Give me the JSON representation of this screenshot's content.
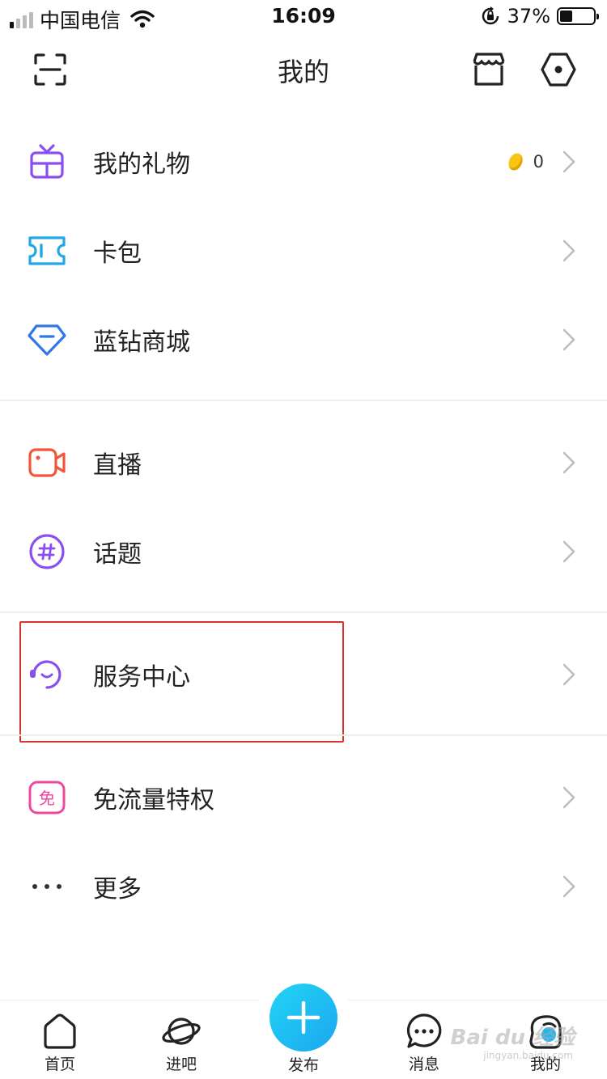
{
  "status_bar": {
    "carrier": "中国电信",
    "time": "16:09",
    "battery_percent": "37%",
    "battery_level": 0.37,
    "signal_bars_active": 1,
    "signal_bars_total": 4
  },
  "header": {
    "title": "我的",
    "left_icon": "scan-icon",
    "right_icons": [
      "store-icon",
      "settings-icon"
    ]
  },
  "menu": {
    "gift": {
      "label": "我的礼物",
      "count": "0",
      "icon": "gift-icon",
      "color": "#8a4ff0"
    },
    "cardpack": {
      "label": "卡包",
      "icon": "ticket-icon",
      "color": "#1fa7e6"
    },
    "bluediamond": {
      "label": "蓝钻商城",
      "icon": "diamond-icon",
      "color": "#2f78e8"
    },
    "live": {
      "label": "直播",
      "icon": "video-camera-icon",
      "color": "#f2563a"
    },
    "topic": {
      "label": "话题",
      "icon": "hashtag-icon",
      "color": "#8a4ff0"
    },
    "service": {
      "label": "服务中心",
      "icon": "headset-icon",
      "color": "#8a4ff0"
    },
    "freeflow": {
      "label": "免流量特权",
      "icon": "free-badge-icon",
      "badge_text": "免",
      "color": "#f0479d"
    },
    "more": {
      "label": "更多",
      "icon": "more-dots-icon"
    }
  },
  "highlight_color": "#d9322f",
  "tabbar": {
    "tabs": [
      {
        "label": "首页",
        "icon": "home-icon"
      },
      {
        "label": "进吧",
        "icon": "planet-icon"
      },
      {
        "label": "发布",
        "icon": "plus-icon"
      },
      {
        "label": "消息",
        "icon": "chat-bubble-icon"
      },
      {
        "label": "我的",
        "icon": "profile-face-icon"
      }
    ],
    "publish_color": "#1fb5f2"
  },
  "watermark": {
    "text": "Bai du 经验",
    "sub": "jingyan.baidu.com"
  }
}
